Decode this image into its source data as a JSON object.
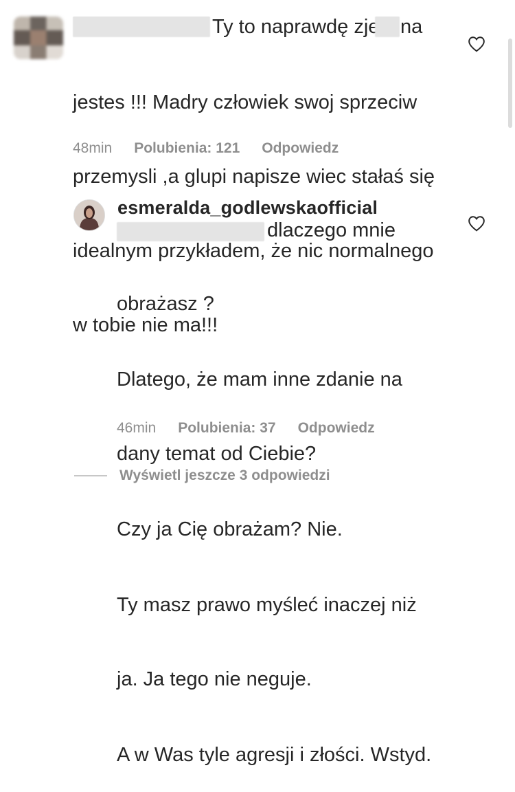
{
  "comment": {
    "visible_text_after_blur": "Ty to naprawdę zje",
    "blur_segment": "na",
    "lines": [
      "jestes !!! Madry człowiek swoj sprzeciw",
      "przemysli ,a glupi napisze wiec stałaś się",
      "idealnym przykładem, że nic normalnego",
      "w tobie nie ma!!!"
    ],
    "time": "48min",
    "likes": "Polubienia: 121",
    "reply": "Odpowiedz"
  },
  "reply_comment": {
    "username": "esmeralda_godlewskaofficial",
    "first_line": "dlaczego mnie",
    "lines": [
      "obrażasz ?",
      "Dlatego, że mam inne zdanie na",
      "dany temat od Ciebie?",
      "Czy ja Cię obrażam? Nie.",
      "Ty masz prawo myśleć inaczej niż",
      "ja. Ja tego nie neguje.",
      "A w Was tyle agresji i złości. Wstyd."
    ],
    "time": "46min",
    "likes": "Polubienia: 37",
    "reply": "Odpowiedz"
  },
  "view_more": "Wyświetl jeszcze 3 odpowiedzi",
  "colors": {
    "text": "#262626",
    "meta": "#8e8e8e",
    "blur": "#e4e4e4"
  },
  "icons": [
    "heart-icon"
  ]
}
